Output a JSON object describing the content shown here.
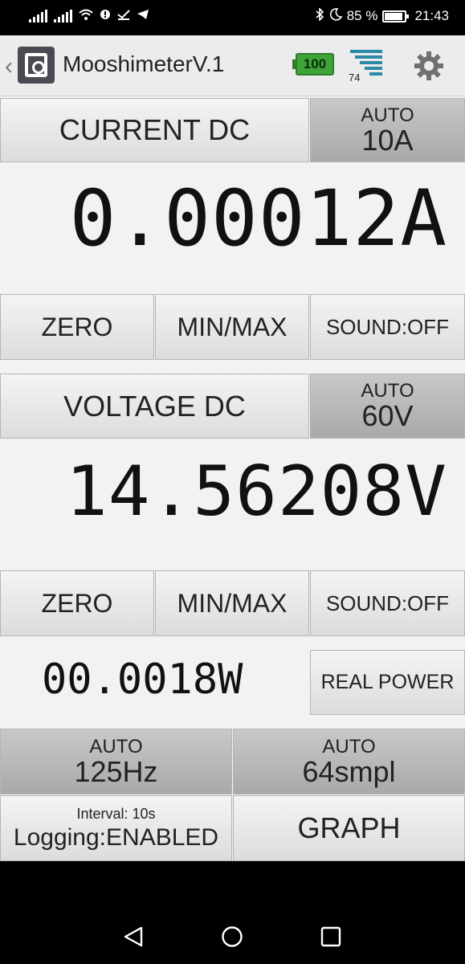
{
  "status_bar": {
    "battery_percent": "85 %",
    "time": "21:43",
    "icons": [
      "signal-icon",
      "signal-icon",
      "wifi-icon",
      "notification-icon",
      "check-icon",
      "telegram-icon",
      "bluetooth-icon",
      "moon-icon",
      "battery-icon"
    ]
  },
  "action_bar": {
    "title": "MooshimeterV.1",
    "battery_level": "100",
    "signal_value": "74"
  },
  "channel1": {
    "mode": "CURRENT DC",
    "range_mode": "AUTO",
    "range_value": "10A",
    "reading": "0.00012A",
    "zero": "ZERO",
    "minmax": "MIN/MAX",
    "sound": "SOUND:OFF"
  },
  "channel2": {
    "mode": "VOLTAGE DC",
    "range_mode": "AUTO",
    "range_value": "60V",
    "reading": "14.56208V",
    "zero": "ZERO",
    "minmax": "MIN/MAX",
    "sound": "SOUND:OFF"
  },
  "power": {
    "reading": "00.0018W",
    "mode": "REAL POWER"
  },
  "settings": {
    "rate_mode": "AUTO",
    "rate_value": "125Hz",
    "depth_mode": "AUTO",
    "depth_value": "64smpl",
    "logging_interval": "Interval: 10s",
    "logging_status": "Logging:ENABLED",
    "graph": "GRAPH"
  }
}
